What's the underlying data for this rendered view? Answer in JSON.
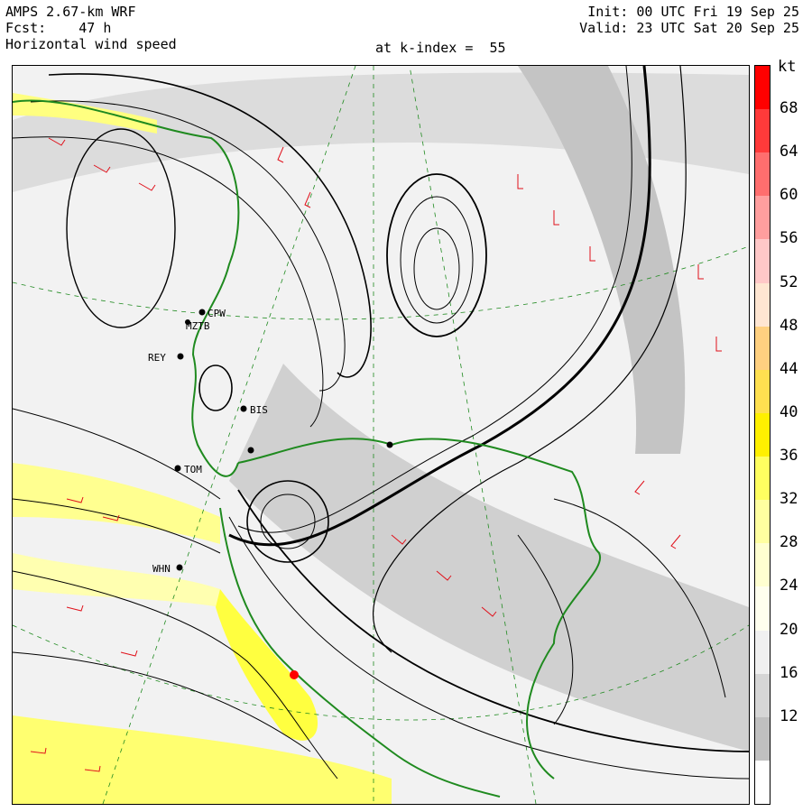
{
  "header": {
    "model": "AMPS 2.67-km WRF",
    "forecast_label": "Fcst:",
    "forecast_hours": "47 h",
    "field": "Horizontal wind speed",
    "level_label": "at k-index =",
    "level_value": "55",
    "init_label": "Init:",
    "init_time": "00 UTC Fri 19 Sep 25",
    "valid_label": "Valid:",
    "valid_time": "23 UTC Sat 20 Sep 25"
  },
  "colorbar": {
    "unit": "kt",
    "ticks": [
      "68",
      "64",
      "60",
      "56",
      "52",
      "48",
      "44",
      "40",
      "36",
      "32",
      "28",
      "24",
      "20",
      "16",
      "12"
    ],
    "colors": [
      "#ff0000",
      "#ff3a3a",
      "#ff6e6e",
      "#ff9e9e",
      "#ffc8c8",
      "#ffe6d2",
      "#ffd080",
      "#ffe050",
      "#fff000",
      "#ffff60",
      "#ffffa0",
      "#ffffd0",
      "#ffffee",
      "#f0f0f0",
      "#d6d6d6",
      "#c0c0c0",
      "#ffffff"
    ]
  },
  "map": {
    "stations": [
      {
        "code": "CPW"
      },
      {
        "code": "MZTB"
      },
      {
        "code": "REY"
      },
      {
        "code": "BIS"
      },
      {
        "code": "TOM"
      },
      {
        "code": "WHN"
      }
    ],
    "colors": {
      "coast": "#1f8a1f",
      "barbs": "#e0101a",
      "streamlines": "#000000",
      "grid": "#1f8a1f",
      "shading_light": "#e4e4e4",
      "shading_dark": "#b8b8b8",
      "shading_yellow": "#ffff60",
      "max_wind": "#ff0000"
    }
  }
}
